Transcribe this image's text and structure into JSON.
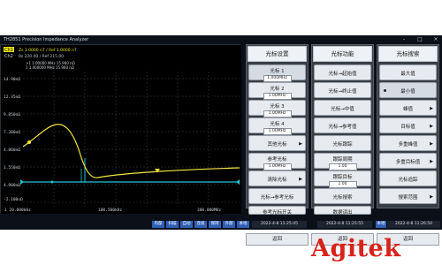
{
  "window": {
    "title": "TH2851 Precision Impedance Analyzer",
    "minimize": "-",
    "restore": "□",
    "close": "×"
  },
  "trace_header": {
    "ch1": "Ch1",
    "ch2": "Ch2",
    "row1": "Zs    1.0000  n7 / Ref  1.0000 n7",
    "row2": "θz   220.00    / Ref  215.00",
    "marker_row1": ">1  1.00000 MHz  15.960 nΩ",
    "marker_row2": "1  1.000000 MHz  15.960 nΩ"
  },
  "plot": {
    "y_ticks": [
      "14.90nΩ",
      "12.35nΩ",
      "9.850nΩ",
      "7.380nΩ",
      "4.860nΩ",
      "1.550nΩ",
      "4.900nΩ",
      "-2.100nΩ",
      "-6.1nΩ"
    ],
    "x_left": "1 20.000kHz",
    "x_mid": "100.500kHz",
    "x_right": "300.000MHz",
    "trace_color": "#f2e640",
    "ref_color": "#25c4d4"
  },
  "panels": {
    "marker_settings": {
      "title": "光标设置",
      "items": [
        {
          "label": "光标 1",
          "value": "1.000MHz"
        },
        {
          "label": "光标 2",
          "value": "1.00MHz"
        },
        {
          "label": "光标 3",
          "value": "1.00MHz"
        },
        {
          "label": "光标 4",
          "value": "1.00MHz"
        },
        {
          "label": "其他光标"
        },
        {
          "label": "参考光标",
          "value": "1.00MHz"
        },
        {
          "label": "清除光标"
        },
        {
          "label": "光标→参考光标"
        },
        {
          "label": "参考光标开关"
        }
      ],
      "back": "返回"
    },
    "marker_functions": {
      "title": "光标功能",
      "items": [
        {
          "label": "光标→起始值"
        },
        {
          "label": "光标→终止值"
        },
        {
          "label": "光标→中值"
        },
        {
          "label": "光标→参考值"
        },
        {
          "label": "光标跟踪"
        },
        {
          "label": "跟踪周期",
          "value": "1.00"
        },
        {
          "label": "跟踪目标",
          "value": "1.00"
        },
        {
          "label": "光标搜索"
        },
        {
          "label": "数据读出"
        }
      ],
      "back": "返回"
    },
    "marker_search": {
      "title": "光标搜索",
      "items": [
        {
          "label": "最大值"
        },
        {
          "label": "最小值"
        },
        {
          "label": "峰值"
        },
        {
          "label": "目标值"
        },
        {
          "label": "多重峰值"
        },
        {
          "label": "多重目标值"
        },
        {
          "label": "光标追踪"
        },
        {
          "label": "搜索范围"
        }
      ],
      "back": "返回"
    }
  },
  "statusbar": {
    "items": [
      "内部",
      "扫描",
      "自动",
      "连续",
      "保持",
      "外部",
      "本地"
    ],
    "time1": "2022-4-8 11:25:45",
    "time2": "2022-4-8 11:25:55",
    "badge": "本地",
    "time3": "2022-4-8 11:26:50"
  },
  "logo": {
    "text": "Agitek",
    "color": "#d8231c"
  }
}
